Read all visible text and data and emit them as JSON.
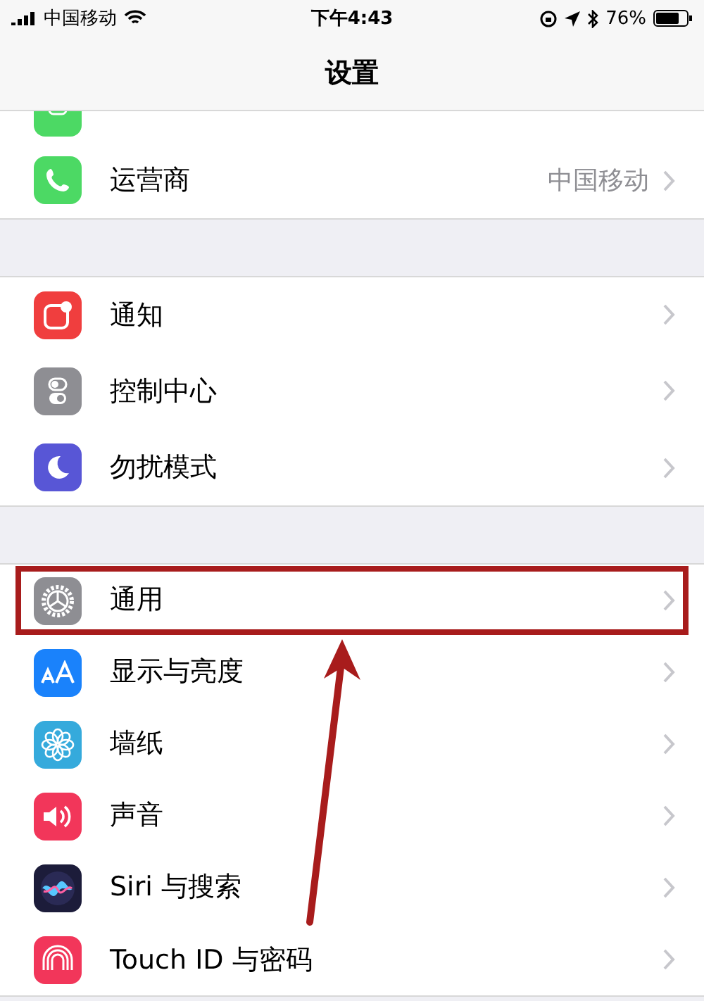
{
  "status_bar": {
    "carrier": "中国移动",
    "time": "下午4:43",
    "battery": "76%"
  },
  "nav": {
    "title": "设置"
  },
  "groups": [
    {
      "rows": [
        {
          "kind": "hotspot",
          "color": "#4cd964",
          "highlighted": false
        },
        {
          "kind": "phone",
          "color": "#4cd964",
          "label": "运营商",
          "value": "中国移动",
          "highlighted": false
        }
      ]
    },
    {
      "rows": [
        {
          "kind": "notify",
          "color": "#f03e3e",
          "label": "通知",
          "highlighted": false
        },
        {
          "kind": "control",
          "color": "#8e8e93",
          "label": "控制中心",
          "highlighted": false
        },
        {
          "kind": "moon",
          "color": "#5856d6",
          "label": "勿扰模式",
          "highlighted": false
        }
      ]
    },
    {
      "rows": [
        {
          "kind": "gear",
          "color": "#8e8e93",
          "label": "通用",
          "highlighted": true
        },
        {
          "kind": "text",
          "color": "#1a82fb",
          "label": "显示与亮度",
          "highlighted": false
        },
        {
          "kind": "flower",
          "color": "#35aadc",
          "label": "墙纸",
          "highlighted": false
        },
        {
          "kind": "sound",
          "color": "#f2365a",
          "label": "声音",
          "highlighted": false
        },
        {
          "kind": "siri",
          "color": "#1c1c3a",
          "label": "Siri 与搜索",
          "highlighted": false
        },
        {
          "kind": "finger",
          "color": "#f2365a",
          "label": "Touch ID 与密码",
          "highlighted": false
        }
      ]
    }
  ]
}
